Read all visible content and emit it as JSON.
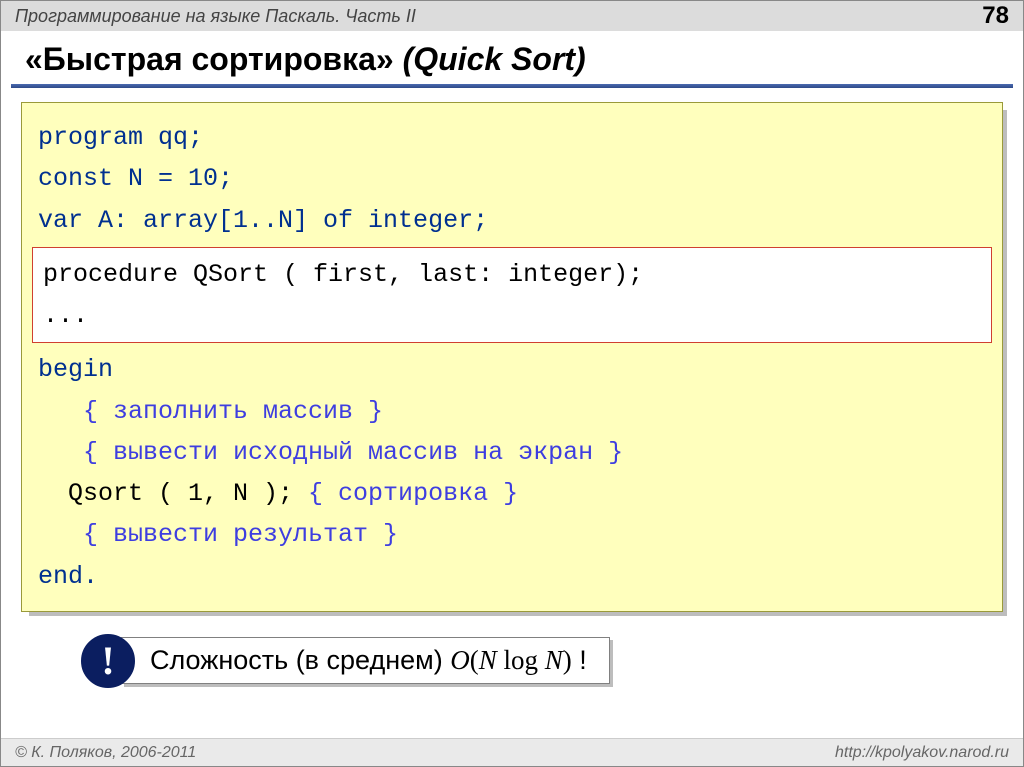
{
  "header": {
    "course_title": "Программирование на языке Паскаль. Часть II",
    "page_number": "78"
  },
  "title": {
    "quoted": "«Быстрая сортировка»",
    "paren": "(Quick Sort)"
  },
  "code": {
    "l1": "program qq;",
    "l2": "const N = 10;",
    "l3": "var A: array[1..N] of integer;",
    "box_l1": "procedure QSort ( first, last: integer);",
    "box_l2": "...",
    "l4": "begin",
    "l5_comment": "   { заполнить массив }",
    "l6_comment": "   { вывести исходный массив на экран }",
    "l7_pre": "  Qsort ( 1, N ); ",
    "l7_comment": "{ сортировка }",
    "l8_comment": "   { вывести результат }",
    "l9": "end."
  },
  "bang": "!",
  "complexity": {
    "label": "Сложность (в среднем) ",
    "formula_O": "O",
    "formula_open": "(",
    "formula_N1": "N",
    "formula_log": " log ",
    "formula_N2": "N",
    "formula_close": ")",
    "excl": " !"
  },
  "footer": {
    "copyright": "© К. Поляков, 2006-2011",
    "url": "http://kpolyakov.narod.ru"
  }
}
